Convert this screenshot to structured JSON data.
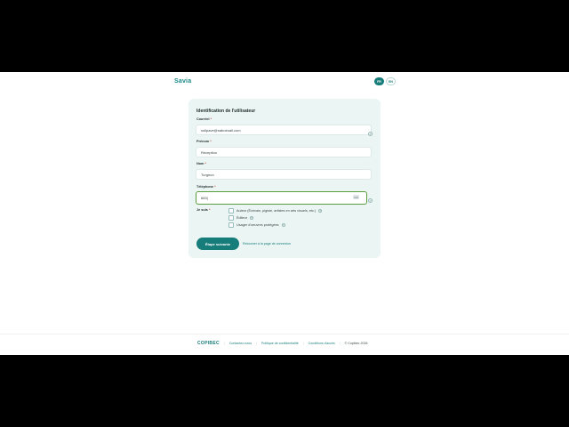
{
  "app": {
    "brand": "Savia"
  },
  "lang": {
    "active": "FR",
    "other": "EN"
  },
  "form": {
    "title": "Identification de l'utilisateur",
    "email_label": "Courriel",
    "email_value": "sollpave@naboimail.com",
    "firstname_label": "Prénom",
    "firstname_value": "Reception",
    "lastname_label": "Nom",
    "lastname_value": "Turgeon",
    "phone_label": "Téléphone",
    "phone_value": "683|",
    "phone_country": "CA",
    "role_label": "Je suis",
    "required_mark": "*",
    "options": [
      "Auteur (Écrivain, pigiste, artistes en arts visuels, etc.)",
      "Éditeur",
      "Usager d'oeuvres protégées"
    ],
    "next_button": "Étape suivante",
    "back_link": "Retourner à la page de connexion"
  },
  "footer": {
    "logo": "COPIBEC",
    "links": [
      "Contactez-nous",
      "Politique de confidentialité",
      "Conditions d'accès"
    ],
    "copyright": "© Copibec 2026"
  },
  "colors": {
    "accent": "#177d7b",
    "card": "#eaf5f4",
    "focus": "#5a9d3f"
  }
}
